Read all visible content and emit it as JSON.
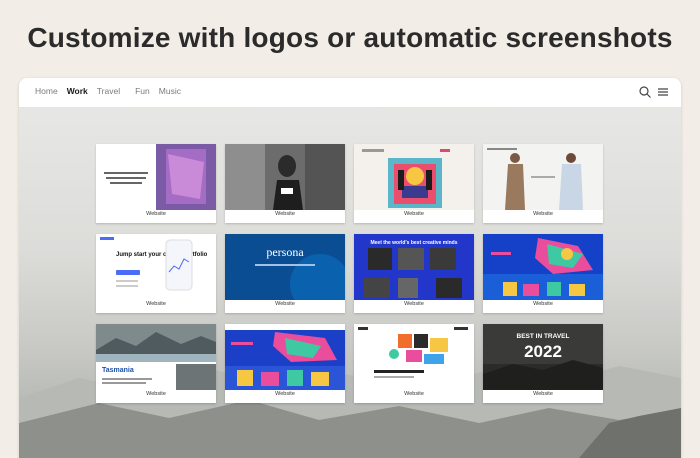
{
  "headline": "Customize with logos or automatic screenshots",
  "nav": {
    "items": [
      {
        "label": "Home",
        "active": false
      },
      {
        "label": "Work",
        "active": true
      },
      {
        "label": "Travel",
        "active": false
      },
      {
        "label": "Fun",
        "active": false
      },
      {
        "label": "Music",
        "active": false
      }
    ]
  },
  "toolbar_icons": [
    "search-icon",
    "menu-icon"
  ],
  "cards": [
    {
      "caption": "Website",
      "thumb": "knitwear-editorial"
    },
    {
      "caption": "Website",
      "thumb": "street-portrait"
    },
    {
      "caption": "Website",
      "thumb": "art-poster"
    },
    {
      "caption": "Website",
      "thumb": "fashion-models"
    },
    {
      "caption": "Website",
      "thumb": "crypto-app",
      "text": "Jump start your crypto portfolio"
    },
    {
      "caption": "Website",
      "thumb": "persona",
      "text": "persona"
    },
    {
      "caption": "Website",
      "thumb": "creative-minds",
      "text": "Meet the world's best creative minds"
    },
    {
      "caption": "Website",
      "thumb": "sports-colorful"
    },
    {
      "caption": "Website",
      "thumb": "tasmania",
      "text": "Tasmania"
    },
    {
      "caption": "Website",
      "thumb": "sports-colorful-2"
    },
    {
      "caption": "Website",
      "thumb": "colorful-illustration"
    },
    {
      "caption": "Website",
      "thumb": "travel-2022",
      "text": "BEST IN TRAVEL",
      "year": "2022"
    }
  ]
}
